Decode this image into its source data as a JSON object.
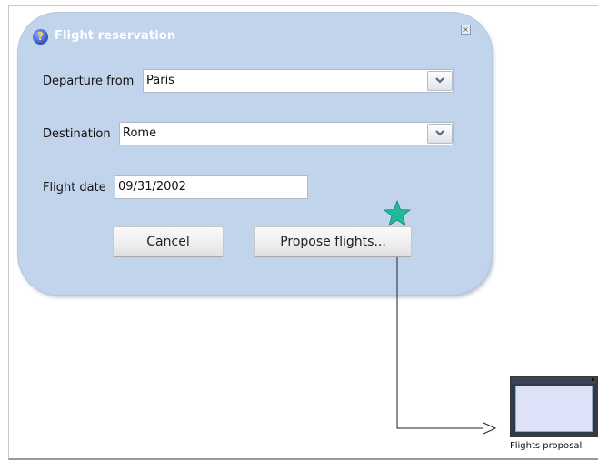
{
  "dialog": {
    "title": "Flight reservation",
    "help_icon": "question-help-icon",
    "close_icon": "close-x-icon",
    "departure": {
      "label": "Departure from",
      "value": "Paris"
    },
    "destination": {
      "label": "Destination",
      "value": "Rome"
    },
    "flight_date": {
      "label": "Flight date",
      "value": "09/31/2002"
    },
    "cancel_label": "Cancel",
    "propose_label": "Propose flights..."
  },
  "annotations": {
    "star_icon": "green-star-icon",
    "star_color": "#22b89a"
  },
  "target_screen": {
    "label": "Flights proposal",
    "icon": "screen-thumbnail-icon"
  },
  "colors": {
    "dialog_bg": "#c2d4ec",
    "title_text": "#ffffff"
  }
}
